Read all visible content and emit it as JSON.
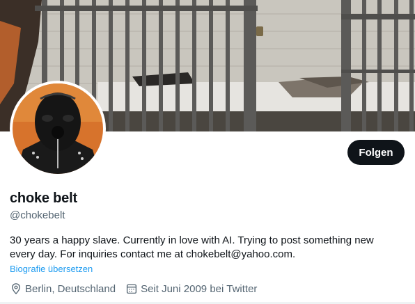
{
  "profile": {
    "display_name": "choke belt",
    "handle": "@chokebelt",
    "bio": "30 years a happy slave. Currently in love with AI. Trying to post something new every day. For inquiries contact me at chokebelt@yahoo.com.",
    "translate_label": "Biografie übersetzen",
    "location": "Berlin, Deutschland",
    "joined": "Seit Juni 2009 bei Twitter"
  },
  "actions": {
    "follow_label": "Folgen"
  },
  "icons": {
    "location": "map-pin-icon",
    "joined": "calendar-icon"
  },
  "colors": {
    "button_bg": "#0f1419",
    "link": "#1d9bf0",
    "secondary_text": "#536471"
  }
}
